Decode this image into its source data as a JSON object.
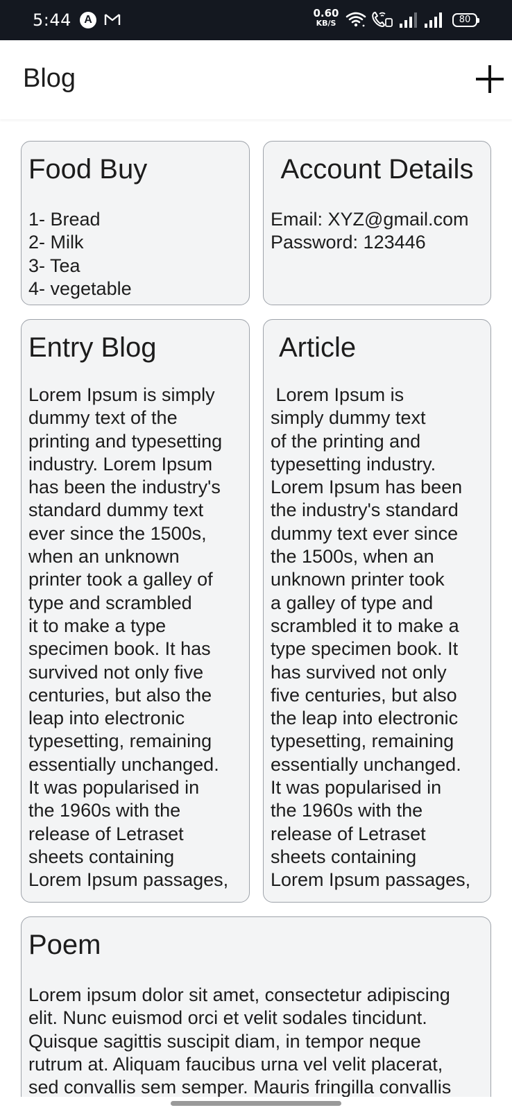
{
  "status_bar": {
    "time": "5:44",
    "a_icon_letter": "A",
    "net_speed_value": "0.60",
    "net_speed_unit": "KB/S",
    "battery": "80"
  },
  "app_bar": {
    "title": "Blog",
    "add_icon": "plus-icon"
  },
  "cards": [
    {
      "title": "Food Buy",
      "body": "1- Bread\n2- Milk\n3- Tea\n4- vegetable"
    },
    {
      "title": "Account Details",
      "body": "Email: XYZ@gmail.com\nPassword: 123446"
    },
    {
      "title": "Entry Blog",
      "body": "Lorem Ipsum is simply\ndummy text of the\nprinting and typesetting\nindustry. Lorem Ipsum\nhas been the industry's\nstandard dummy text\never since the 1500s,\nwhen an unknown\nprinter took a galley of\ntype and scrambled\nit to make a type\nspecimen book. It has\nsurvived not only five\ncenturies, but also the\nleap into electronic\ntypesetting, remaining\nessentially unchanged.\nIt was popularised in\nthe 1960s with the\nrelease of Letraset\nsheets containing\nLorem Ipsum passages,"
    },
    {
      "title": "Article",
      "body": " Lorem Ipsum is\nsimply dummy text\nof the printing and\ntypesetting industry.\nLorem Ipsum has been\nthe industry's standard\ndummy text ever since\nthe 1500s, when an\nunknown printer took\na galley of type and\nscrambled it to make a\ntype specimen book. It\nhas survived not only\nfive centuries, but also\nthe leap into electronic\ntypesetting, remaining\nessentially unchanged.\nIt was popularised in\nthe 1960s with the\nrelease of Letraset\nsheets containing\nLorem Ipsum passages,"
    },
    {
      "title": "Poem",
      "body": "Lorem ipsum dolor sit amet, consectetur adipiscing\nelit. Nunc euismod orci et velit sodales tincidunt.\nQuisque sagittis suscipit diam, in tempor neque\nrutrum at. Aliquam faucibus urna vel velit placerat,\nsed convallis sem semper. Mauris fringilla convallis"
    }
  ],
  "colors": {
    "status_bar_bg": "#141820",
    "card_bg": "#f3f4f5",
    "card_border": "#9ea3aa",
    "text": "#1c1c1c"
  }
}
